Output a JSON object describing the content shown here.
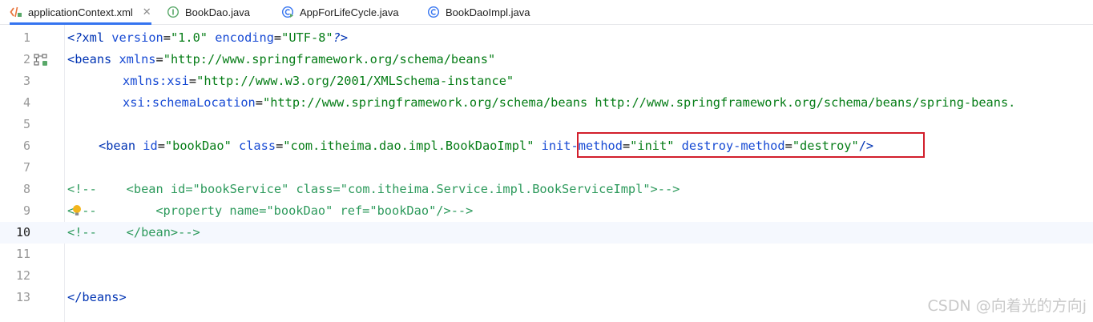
{
  "tabs": [
    {
      "label": "applicationContext.xml",
      "icon": "xml-file-icon",
      "active": true,
      "close": "✕"
    },
    {
      "label": "BookDao.java",
      "icon": "interface-icon",
      "active": false
    },
    {
      "label": "AppForLifeCycle.java",
      "icon": "class-run-icon",
      "active": false
    },
    {
      "label": "BookDaoImpl.java",
      "icon": "class-icon",
      "active": false
    }
  ],
  "editor": {
    "current_line": "10",
    "lines": [
      {
        "n": "1"
      },
      {
        "n": "2"
      },
      {
        "n": "3"
      },
      {
        "n": "4"
      },
      {
        "n": "5"
      },
      {
        "n": "6"
      },
      {
        "n": "7"
      },
      {
        "n": "8"
      },
      {
        "n": "9"
      },
      {
        "n": "10"
      },
      {
        "n": "11"
      },
      {
        "n": "12"
      },
      {
        "n": "13"
      }
    ],
    "tokens": {
      "l1": [
        "<?",
        "xml ",
        "version",
        "=",
        "\"1.0\"",
        " ",
        "encoding",
        "=",
        "\"UTF-8\"",
        "?>"
      ],
      "l2": [
        "<beans ",
        "xmlns",
        "=",
        "\"http://www.springframework.org/schema/beans\""
      ],
      "l3": [
        "xmlns:xsi",
        "=",
        "\"http://www.w3.org/2001/XMLSchema-instance\""
      ],
      "l4": [
        "xsi:schemaLocation",
        "=",
        "\"http://www.springframework.org/schema/beans http://www.springframework.org/schema/beans/spring-beans."
      ],
      "l6": [
        "<bean ",
        "id",
        "=",
        "\"bookDao\"",
        " ",
        "class",
        "=",
        "\"com.itheima.dao.impl.BookDaoImpl\"",
        " ",
        "init-method",
        "=",
        "\"init\"",
        " ",
        "destroy-method",
        "=",
        "\"destroy\"",
        "/>"
      ],
      "l8": "<!--    <bean id=\"bookService\" class=\"com.itheima.Service.impl.BookServiceImpl\">-->",
      "l9a": "<",
      "l9b": "--        <property name=\"bookDao\" ref=\"bookDao\"/>-->",
      "l10": "<!--    </bean>-->",
      "l13": "</beans>"
    }
  },
  "gutter_icons": [
    "bean-structure-icon",
    "lightbulb-icon"
  ],
  "watermark": "CSDN @向着光的方向j",
  "colors": {
    "tag": "#0033b3",
    "attribute": "#174ad4",
    "value": "#067d17",
    "comment": "#2d9a5c",
    "highlight_box": "#d21f2c",
    "active_tab_underline": "#3574f0"
  }
}
